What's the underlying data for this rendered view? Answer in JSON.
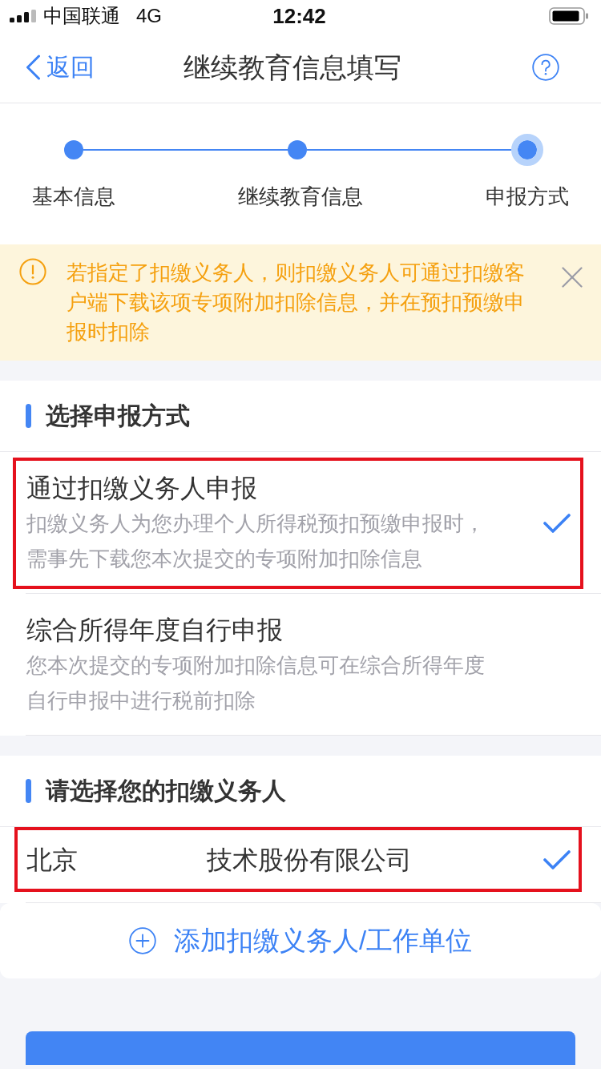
{
  "status_bar": {
    "carrier": "中国联通",
    "network": "4G",
    "time": "12:42"
  },
  "nav_bar": {
    "back_label": "返回",
    "title": "继续教育信息填写"
  },
  "steps": [
    {
      "label": "基本信息",
      "selected": false
    },
    {
      "label": "继续教育信息",
      "selected": false
    },
    {
      "label": "申报方式",
      "selected": true
    }
  ],
  "notice": {
    "text": "若指定了扣缴义务人，则扣缴义务人可通过扣缴客户端下载该项专项附加扣除信息，并在预扣预缴申报时扣除"
  },
  "report_method": {
    "title": "选择申报方式",
    "options": [
      {
        "title": "通过扣缴义务人申报",
        "description": "扣缴义务人为您办理个人所得税预扣预缴申报时，需事先下载您本次提交的专项附加扣除信息",
        "selected": true,
        "highlighted": true
      },
      {
        "title": "综合所得年度自行申报",
        "description": "您本次提交的专项附加扣除信息可在综合所得年度自行申报中进行税前扣除",
        "selected": false,
        "highlighted": false
      }
    ]
  },
  "withholder": {
    "title": "请选择您的扣缴义务人",
    "items": [
      {
        "name_parts": [
          "北京",
          "技术股份有限公司"
        ],
        "selected": true,
        "highlighted": true
      }
    ],
    "add_label": "添加扣缴义务人/工作单位"
  }
}
